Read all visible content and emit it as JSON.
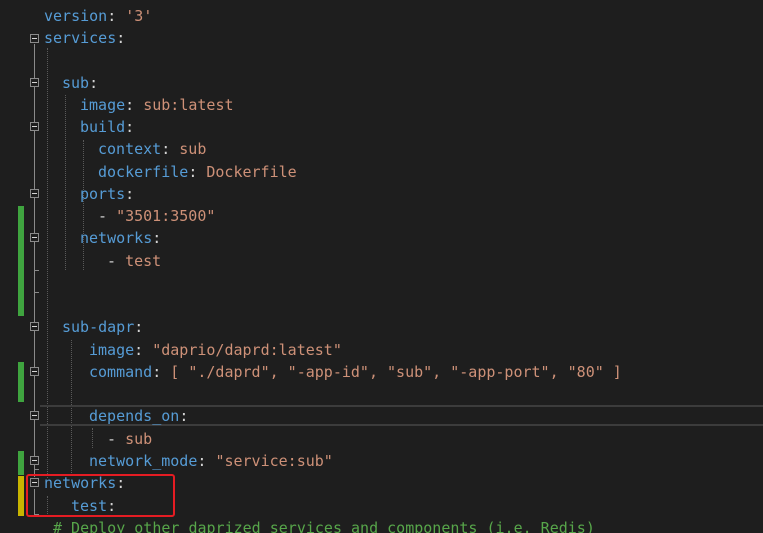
{
  "editor": {
    "accent_colors": {
      "key": "#569cd6",
      "string": "#ce9178",
      "comment": "#57a64a",
      "change_bar": "#3fa43f",
      "annotation_box": "#e51c23"
    },
    "lines": [
      {
        "key": "version",
        "sep": ": ",
        "value": "'3'"
      },
      {
        "key": "services",
        "sep": ":"
      },
      {
        "key": "sub",
        "sep": ":"
      },
      {
        "key": "image",
        "sep": ": ",
        "value": "sub:latest"
      },
      {
        "key": "build",
        "sep": ":"
      },
      {
        "key": "context",
        "sep": ": ",
        "value": "sub"
      },
      {
        "key": "dockerfile",
        "sep": ": ",
        "value": "Dockerfile"
      },
      {
        "key": "ports",
        "sep": ":"
      },
      {
        "dash": "- ",
        "value": "\"3501:3500\""
      },
      {
        "key": "networks",
        "sep": ":"
      },
      {
        "dash": "- ",
        "value": "test"
      },
      {
        "key": "sub-dapr",
        "sep": ":"
      },
      {
        "key": "image",
        "sep": ": ",
        "value": "\"daprio/daprd:latest\""
      },
      {
        "key": "command",
        "sep": ": ",
        "value": "[ \"./daprd\", \"-app-id\", \"sub\", \"-app-port\", \"80\" ]"
      },
      {
        "key": "depends_on",
        "sep": ":"
      },
      {
        "dash": "- ",
        "value": "sub"
      },
      {
        "key": "network_mode",
        "sep": ": ",
        "value": "\"service:sub\""
      },
      {
        "key": "networks",
        "sep": ":"
      },
      {
        "key": "test",
        "sep": ":"
      },
      {
        "comment": "# Deploy other daprized services and components (i.e. Redis)"
      }
    ]
  }
}
